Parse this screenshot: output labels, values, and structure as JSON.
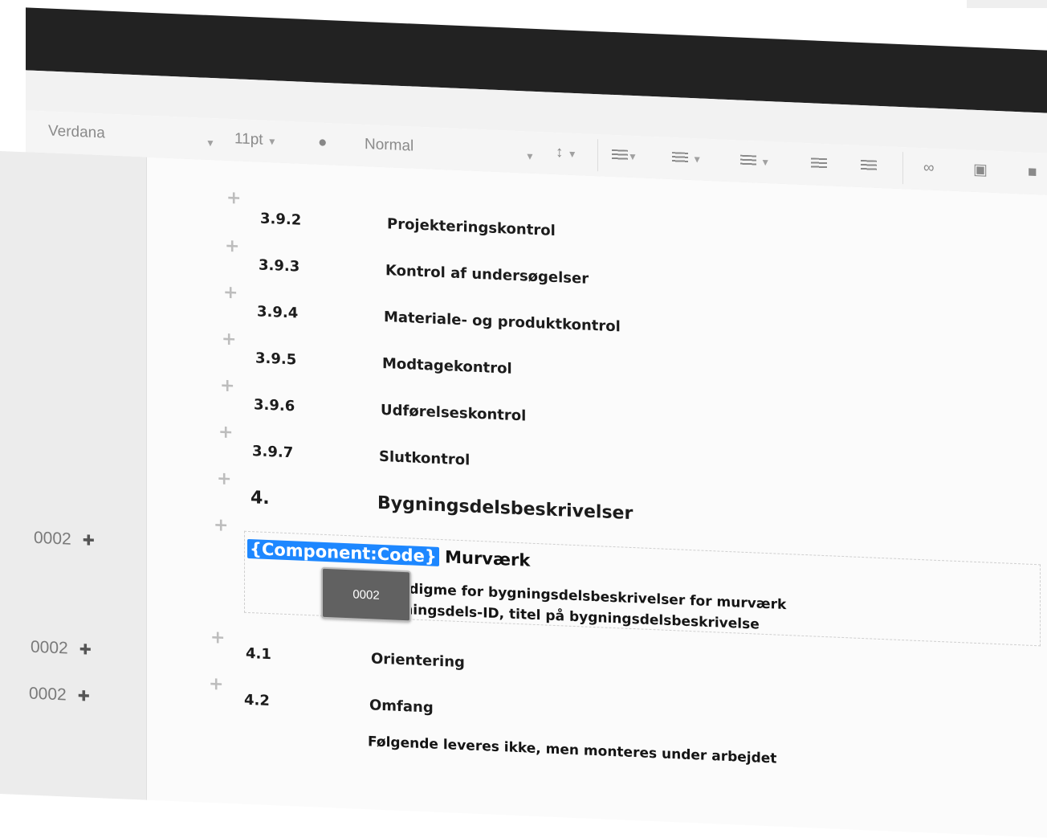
{
  "toolbar": {
    "font_family": "Verdana",
    "font_size": "11pt",
    "style": "Normal"
  },
  "sections": [
    {
      "num": "3.9.2",
      "title": "Projekteringskontrol"
    },
    {
      "num": "3.9.3",
      "title": "Kontrol af undersøgelser"
    },
    {
      "num": "3.9.4",
      "title": "Materiale- og produktkontrol"
    },
    {
      "num": "3.9.5",
      "title": "Modtagekontrol"
    },
    {
      "num": "3.9.6",
      "title": "Udførelseskontrol"
    },
    {
      "num": "3.9.7",
      "title": "Slutkontrol"
    },
    {
      "num": "4.",
      "title": "Bygningsdelsbeskrivelser"
    }
  ],
  "component": {
    "tag": "{Component:Code}",
    "title": "Murværk",
    "line1": "Paradigme for bygningsdelsbeskrivelser for murværk",
    "line2": "Bygningsdels-ID, titel på bygningsdelsbeskrivelse",
    "tooltip": "0002"
  },
  "subsections": [
    {
      "num": "4.1",
      "title": "Orientering"
    },
    {
      "num": "4.2",
      "title": "Omfang"
    }
  ],
  "footer_text": "Følgende leveres ikke, men monteres under arbejdet",
  "side_codes": [
    "0002",
    "0002",
    "0002"
  ],
  "colors": {
    "accent": "#1d87ff",
    "topbar": "#222222"
  }
}
